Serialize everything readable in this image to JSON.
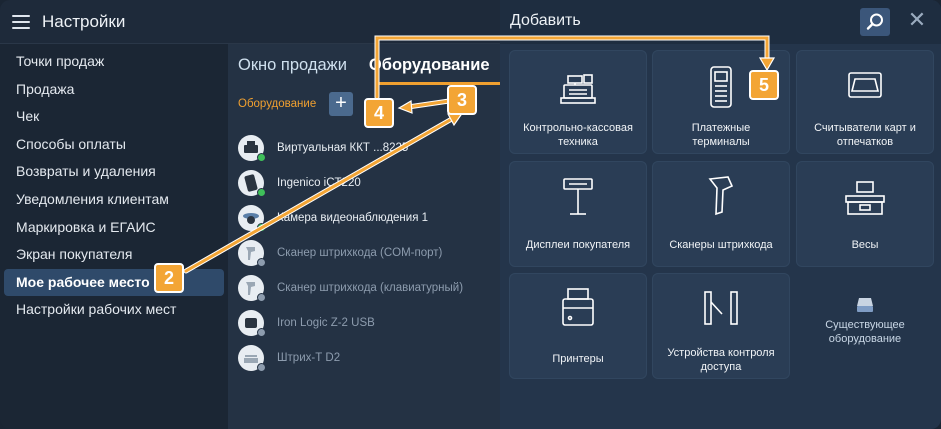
{
  "app": {
    "title": "Настройки"
  },
  "menu": {
    "items": [
      {
        "label": "Точки продаж"
      },
      {
        "label": "Продажа"
      },
      {
        "label": "Чек"
      },
      {
        "label": "Способы оплаты"
      },
      {
        "label": "Возвраты и удаления"
      },
      {
        "label": "Уведомления клиентам"
      },
      {
        "label": "Маркировка и ЕГАИС"
      },
      {
        "label": "Экран покупателя"
      },
      {
        "label": "Мое рабочее место"
      },
      {
        "label": "Настройки рабочих мест"
      }
    ],
    "active_index": 8
  },
  "middle": {
    "tabs": [
      {
        "label": "Окно продажи"
      },
      {
        "label": "Оборудование"
      }
    ],
    "active_tab": 1,
    "equipment_label": "Оборудование",
    "add_label": "+",
    "devices": [
      {
        "name": "Виртуальная ККТ ...8225",
        "icon": "cash-register-icon",
        "status_color": "#3fbf5a",
        "enabled": true
      },
      {
        "name": "Ingenico iCT220",
        "icon": "payment-terminal-icon",
        "status_color": "#3fbf5a",
        "enabled": true
      },
      {
        "name": "Камера видеонаблюдения 1",
        "icon": "camera-icon",
        "status_color": "#3fbf5a",
        "enabled": true
      },
      {
        "name": "Сканер штрихкода (COM-порт)",
        "icon": "barcode-scanner-icon",
        "status_color": "#8d9cae",
        "enabled": false
      },
      {
        "name": "Сканер штрихкода (клавиатурный)",
        "icon": "barcode-scanner-icon",
        "status_color": "#8d9cae",
        "enabled": false
      },
      {
        "name": "Iron Logic Z-2 USB",
        "icon": "card-reader-icon",
        "status_color": "#8d9cae",
        "enabled": false
      },
      {
        "name": "Штрих-Т D2",
        "icon": "scale-icon",
        "status_color": "#8d9cae",
        "enabled": false
      }
    ]
  },
  "add_panel": {
    "title": "Добавить",
    "close_label": "✕",
    "tiles": [
      {
        "label": "Контрольно-кассовая\nтехника",
        "icon": "cash-register-icon"
      },
      {
        "label": "Платежные\nтерминалы",
        "icon": "payment-terminal-icon"
      },
      {
        "label": "Считыватели карт и\nотпечатков",
        "icon": "card-reader-icon"
      },
      {
        "label": "Дисплеи покупателя",
        "icon": "customer-display-icon"
      },
      {
        "label": "Сканеры штрихкода",
        "icon": "barcode-scanner-icon"
      },
      {
        "label": "Весы",
        "icon": "scale-icon"
      },
      {
        "label": "Принтеры",
        "icon": "printer-icon"
      },
      {
        "label": "Устройства контроля\nдоступа",
        "icon": "turnstile-icon"
      },
      {
        "label": "Существующее\nоборудование",
        "icon": "hard-drive-icon"
      }
    ]
  },
  "annotations": {
    "badges": [
      "2",
      "3",
      "4",
      "5"
    ],
    "color": "#f3a535"
  }
}
